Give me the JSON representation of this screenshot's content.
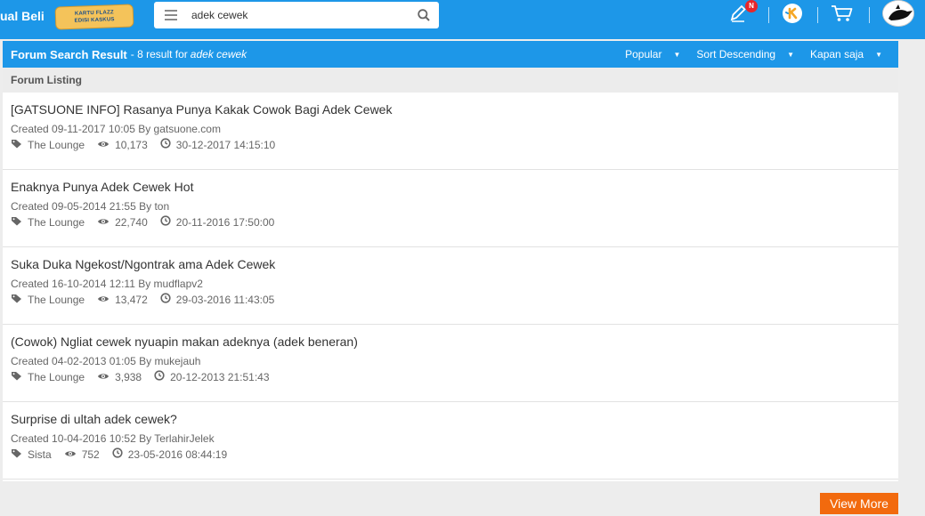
{
  "topbar": {
    "brand_text": "ual Beli",
    "promo_line1": "KARTU FLAZZ",
    "promo_line2": "EDISI KASKUS",
    "search_value": "adek cewek",
    "notification_badge": "N"
  },
  "panel": {
    "title": "Forum Search Result",
    "result_prefix": "- 8 result for",
    "query": "adek cewek",
    "dropdowns": [
      "Popular",
      "Sort Descending",
      "Kapan saja"
    ],
    "listing_label": "Forum Listing"
  },
  "threads": [
    {
      "title": "[GATSUONE INFO] Rasanya Punya Kakak Cowok Bagi Adek Cewek",
      "created": "Created 09-11-2017 10:05 By gatsuone.com",
      "forum": "The Lounge",
      "views": "10,173",
      "last": "30-12-2017 14:15:10"
    },
    {
      "title": "Enaknya Punya Adek Cewek Hot",
      "created": "Created 09-05-2014 21:55 By ton",
      "forum": "The Lounge",
      "views": "22,740",
      "last": "20-11-2016 17:50:00"
    },
    {
      "title": "Suka Duka Ngekost/Ngontrak ama Adek Cewek",
      "created": "Created 16-10-2014 12:11 By mudflapv2",
      "forum": "The Lounge",
      "views": "13,472",
      "last": "29-03-2016 11:43:05"
    },
    {
      "title": "(Cowok) Ngliat cewek nyuapin makan adeknya (adek beneran)",
      "created": "Created 04-02-2013 01:05 By mukejauh",
      "forum": "The Lounge",
      "views": "3,938",
      "last": "20-12-2013 21:51:43"
    },
    {
      "title": "Surprise di ultah adek cewek?",
      "created": "Created 10-04-2016 10:52 By TerlahirJelek",
      "forum": "Sista",
      "views": "752",
      "last": "23-05-2016 08:44:19"
    }
  ],
  "footer": {
    "view_more": "View More"
  },
  "colors": {
    "topbar": "#1d97e8",
    "accent_orange": "#f26a0e"
  },
  "icons": [
    "menu-icon",
    "search-icon",
    "pencil-icon",
    "kaskus-k-icon",
    "cart-icon",
    "tag-icon",
    "eye-icon",
    "clock-icon",
    "caret-down-icon"
  ]
}
